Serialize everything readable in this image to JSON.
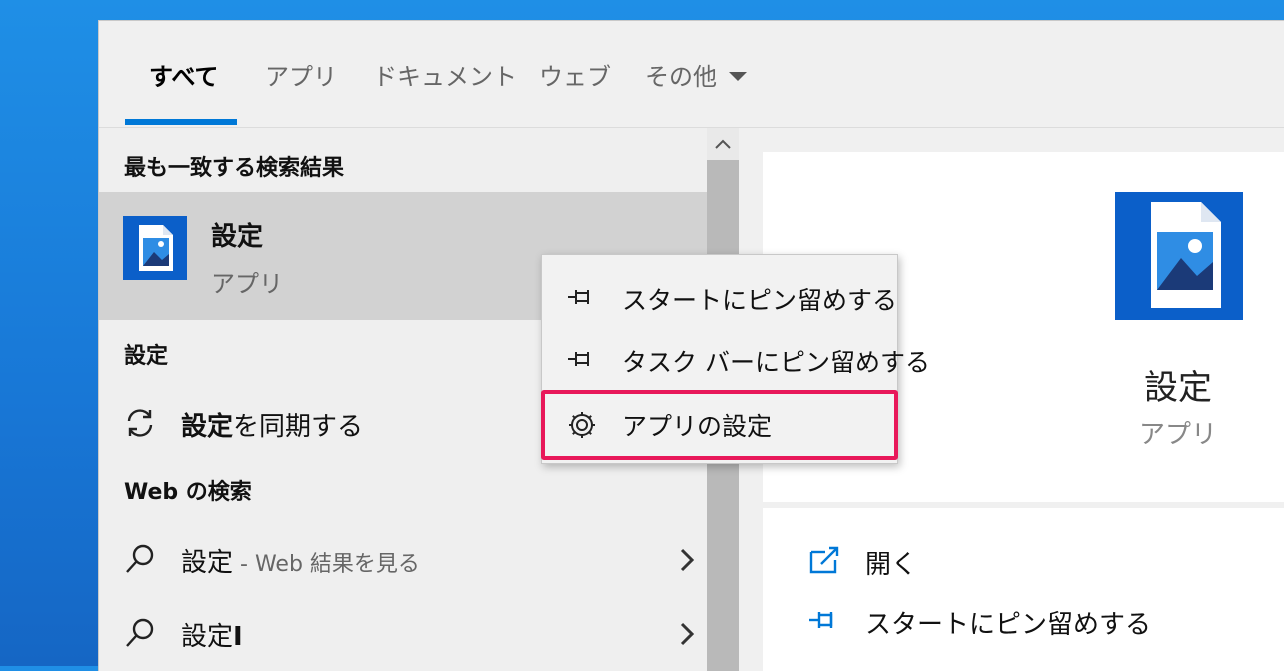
{
  "tabs": {
    "all": "すべて",
    "apps": "アプリ",
    "documents": "ドキュメント",
    "web": "ウェブ",
    "more": "その他"
  },
  "left": {
    "best_match_header": "最も一致する検索結果",
    "best_match": {
      "title": "設定",
      "subtitle": "アプリ"
    },
    "settings_header": "設定",
    "sync_row": {
      "bold": "設定",
      "rest": "を同期する"
    },
    "web_header": "Web の検索",
    "web_rows": [
      {
        "bold": "設定",
        "muted": " - Web 結果を見る"
      },
      {
        "bold": "設定",
        "rest": "I"
      }
    ]
  },
  "right": {
    "title": "設定",
    "subtitle": "アプリ",
    "actions": [
      {
        "label": "開く",
        "icon": "open-icon"
      },
      {
        "label": "スタートにピン留めする",
        "icon": "pin-icon"
      }
    ]
  },
  "context_menu": {
    "items": [
      {
        "label": "スタートにピン留めする",
        "icon": "pin-icon"
      },
      {
        "label": "タスク バーにピン留めする",
        "icon": "pin-icon"
      },
      {
        "label": "アプリの設定",
        "icon": "gear-icon"
      }
    ],
    "highlight_color": "#e8185a"
  },
  "colors": {
    "accent": "#0078d7",
    "app_icon": "#0b5fc9"
  }
}
